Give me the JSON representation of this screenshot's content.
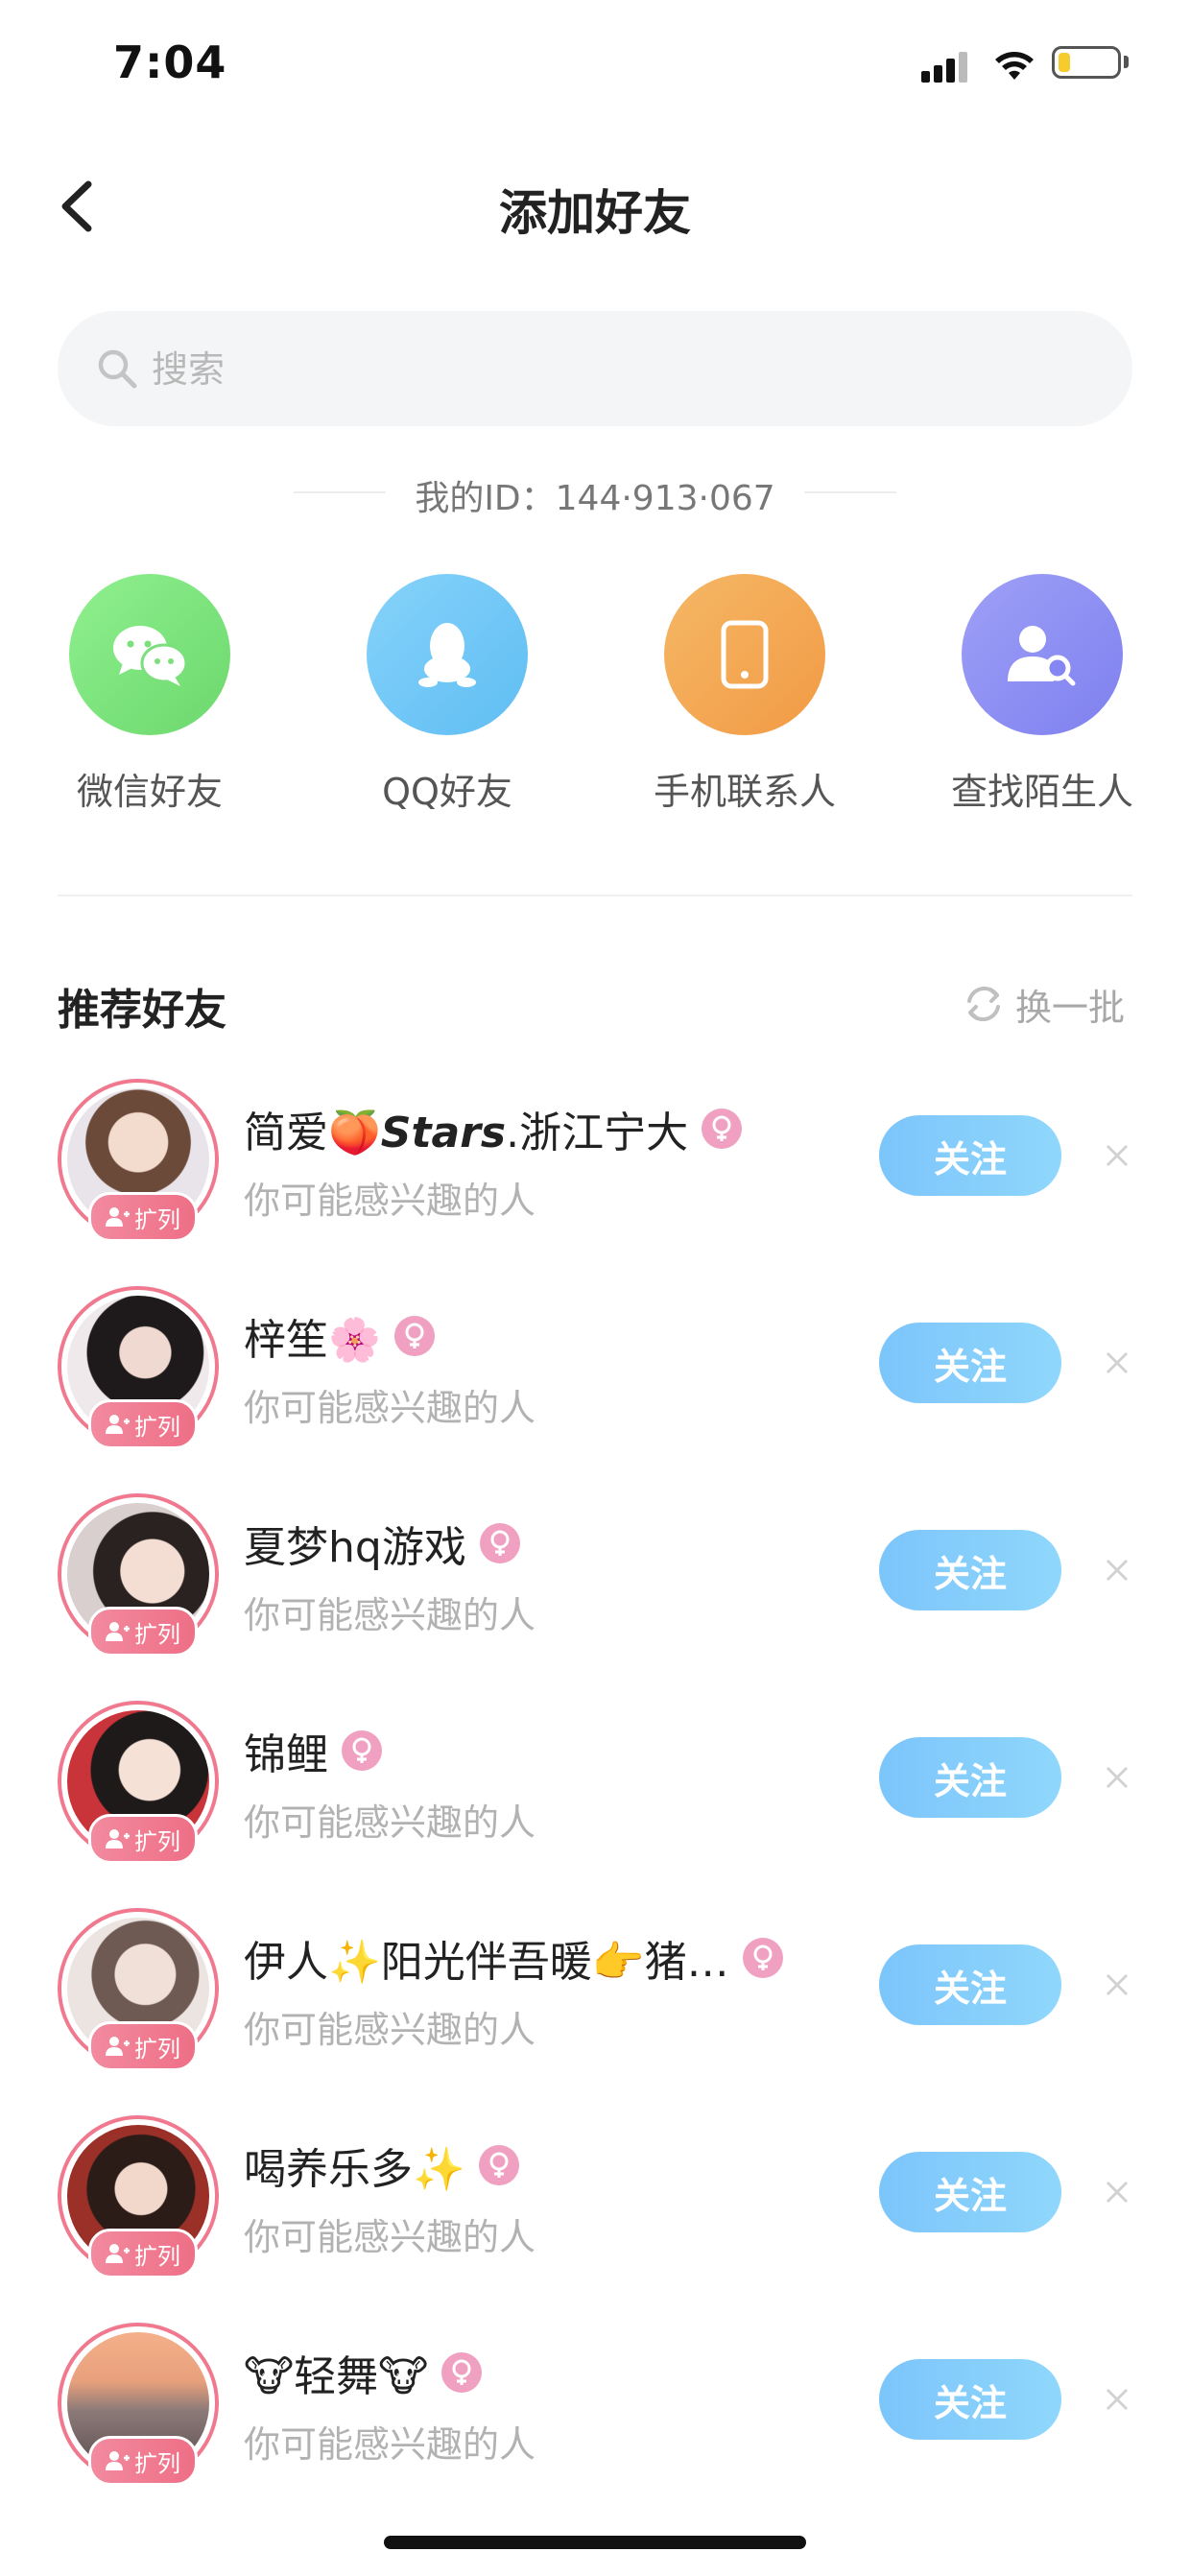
{
  "status_bar": {
    "time": "7:04",
    "battery_level": 0.2,
    "battery_color": "#f5cc2c"
  },
  "header": {
    "title": "添加好友",
    "back_icon": "chevron-left-icon"
  },
  "search": {
    "placeholder": "搜索",
    "value": ""
  },
  "my_id": "我的ID：144·913·067",
  "channels": [
    {
      "label": "微信好友",
      "icon": "wechat-icon",
      "color": "#7fe07f"
    },
    {
      "label": "QQ好友",
      "icon": "qq-penguin-icon",
      "color": "#6fc6f7"
    },
    {
      "label": "手机联系人",
      "icon": "phone-icon",
      "color": "#f6ad58"
    },
    {
      "label": "查找陌生人",
      "icon": "find-person-icon",
      "color": "#8d8ef4"
    }
  ],
  "recommend": {
    "title": "推荐好友",
    "refresh_label": "换一批"
  },
  "friends": [
    {
      "name": "简爱🍑𝙎𝙩𝙖𝙧𝙨.浙江宁大",
      "subtitle": "你可能感兴趣的人",
      "badge": "扩列",
      "follow_label": "关注"
    },
    {
      "name": "梓笙🌸",
      "subtitle": "你可能感兴趣的人",
      "badge": "扩列",
      "follow_label": "关注"
    },
    {
      "name": "夏梦hq游戏",
      "subtitle": "你可能感兴趣的人",
      "badge": "扩列",
      "follow_label": "关注"
    },
    {
      "name": "锦鲤",
      "subtitle": "你可能感兴趣的人",
      "badge": "扩列",
      "follow_label": "关注"
    },
    {
      "name": "伊人✨阳光伴吾暖👉猪…",
      "subtitle": "你可能感兴趣的人",
      "badge": "扩列",
      "follow_label": "关注"
    },
    {
      "name": "喝养乐多✨",
      "subtitle": "你可能感兴趣的人",
      "badge": "扩列",
      "follow_label": "关注"
    },
    {
      "name": "🐮轻舞🐮",
      "subtitle": "你可能感兴趣的人",
      "badge": "扩列",
      "follow_label": "关注"
    }
  ],
  "colors": {
    "follow_button": "#7cc5fb",
    "avatar_ring": "#f0798f",
    "gender_female": "#f0a0c0"
  }
}
